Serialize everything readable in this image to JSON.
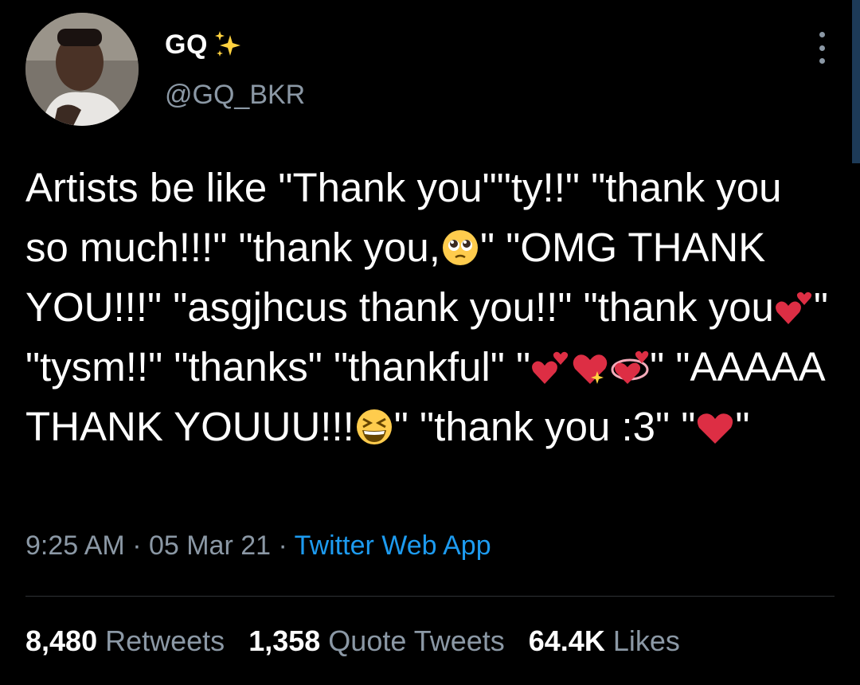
{
  "user": {
    "display_name": "GQ",
    "name_icon": "sparkles-icon",
    "handle": "@GQ_BKR"
  },
  "tweet": {
    "segments": [
      "Artists be like \"Thank you\"\"ty!!\" \"thank you so much!!!\" \"thank you,",
      "\" \"OMG THANK YOU!!!\" \"asgjhcus thank you!!\" \"thank you",
      "\" \"tysm!!\" \"thanks\" \"thankful\" \"",
      "\" \"AAAAA THANK YOUUU!!!",
      "\" \"thank you :3\" \"",
      "\""
    ],
    "emojis": [
      "pleading-face-icon",
      "two-hearts-icon",
      "two-hearts-icon",
      "sparkling-heart-icon",
      "revolving-hearts-icon",
      "grinning-squinting-face-icon",
      "red-heart-icon"
    ]
  },
  "meta": {
    "time": "9:25 AM",
    "sep1": " · ",
    "date": "05 Mar 21",
    "sep2": " · ",
    "source": "Twitter Web App"
  },
  "stats": {
    "retweets_count": "8,480",
    "retweets_label": "Retweets",
    "quotes_count": "1,358",
    "quotes_label": "Quote Tweets",
    "likes_count": "64.4K",
    "likes_label": "Likes"
  },
  "colors": {
    "background": "#000000",
    "secondary_text": "#8b98a5",
    "link": "#1d9bf0",
    "heart": "#e0245e"
  }
}
